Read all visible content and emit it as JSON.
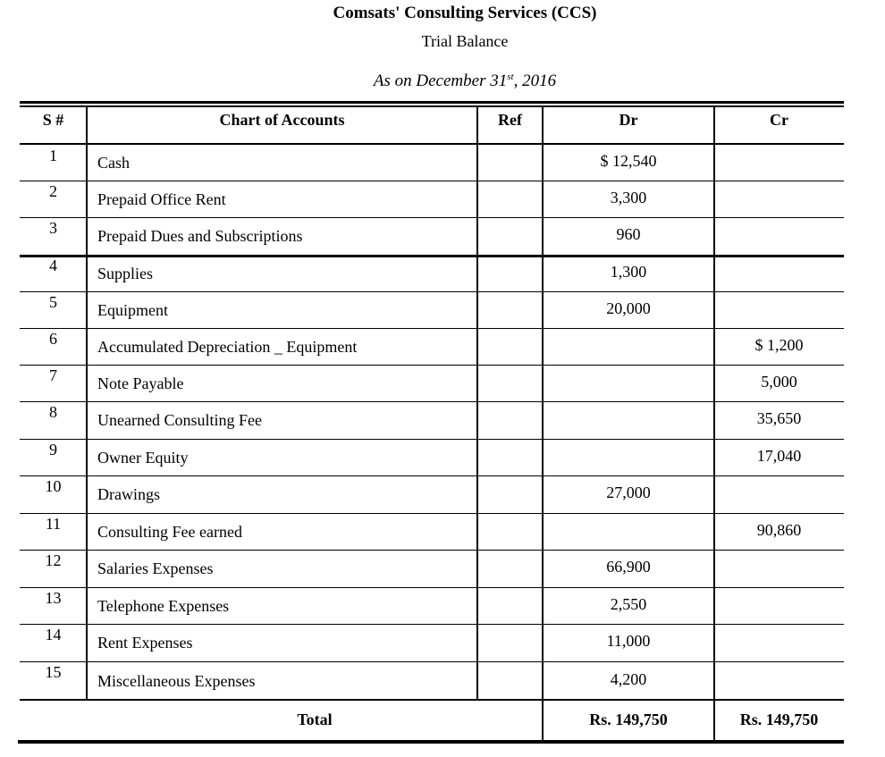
{
  "header": {
    "company": "Comsats' Consulting Services (CCS)",
    "statement": "Trial Balance",
    "date_prefix": "As on December 31",
    "date_suffix_sup": "st",
    "date_year": ", 2016"
  },
  "table": {
    "columns": [
      "S #",
      "Chart of Accounts",
      "Ref",
      "Dr",
      "Cr"
    ],
    "rows": [
      {
        "sn": "1",
        "account": "Cash",
        "ref": "",
        "dr": "$ 12,540",
        "cr": ""
      },
      {
        "sn": "2",
        "account": "Prepaid Office Rent",
        "ref": "",
        "dr": "3,300",
        "cr": ""
      },
      {
        "sn": "3",
        "account": "Prepaid Dues and Subscriptions",
        "ref": "",
        "dr": "960",
        "cr": ""
      },
      {
        "sn": "4",
        "account": "Supplies",
        "ref": "",
        "dr": "1,300",
        "cr": ""
      },
      {
        "sn": "5",
        "account": "Equipment",
        "ref": "",
        "dr": "20,000",
        "cr": ""
      },
      {
        "sn": "6",
        "account": "Accumulated Depreciation _ Equipment",
        "ref": "",
        "dr": "",
        "cr": "$ 1,200"
      },
      {
        "sn": "7",
        "account": "Note Payable",
        "ref": "",
        "dr": "",
        "cr": "5,000"
      },
      {
        "sn": "8",
        "account": "Unearned Consulting Fee",
        "ref": "",
        "dr": "",
        "cr": "35,650"
      },
      {
        "sn": "9",
        "account": "Owner Equity",
        "ref": "",
        "dr": "",
        "cr": "17,040"
      },
      {
        "sn": "10",
        "account": "Drawings",
        "ref": "",
        "dr": "27,000",
        "cr": ""
      },
      {
        "sn": "11",
        "account": "Consulting Fee earned",
        "ref": "",
        "dr": "",
        "cr": "90,860"
      },
      {
        "sn": "12",
        "account": "Salaries Expenses",
        "ref": "",
        "dr": "66,900",
        "cr": ""
      },
      {
        "sn": "13",
        "account": "Telephone Expenses",
        "ref": "",
        "dr": "2,550",
        "cr": ""
      },
      {
        "sn": "14",
        "account": "Rent Expenses",
        "ref": "",
        "dr": "11,000",
        "cr": ""
      },
      {
        "sn": "15",
        "account": "Miscellaneous Expenses",
        "ref": "",
        "dr": "4,200",
        "cr": ""
      }
    ],
    "total": {
      "label": "Total",
      "dr": "Rs. 149,750",
      "cr": "Rs. 149,750"
    }
  }
}
